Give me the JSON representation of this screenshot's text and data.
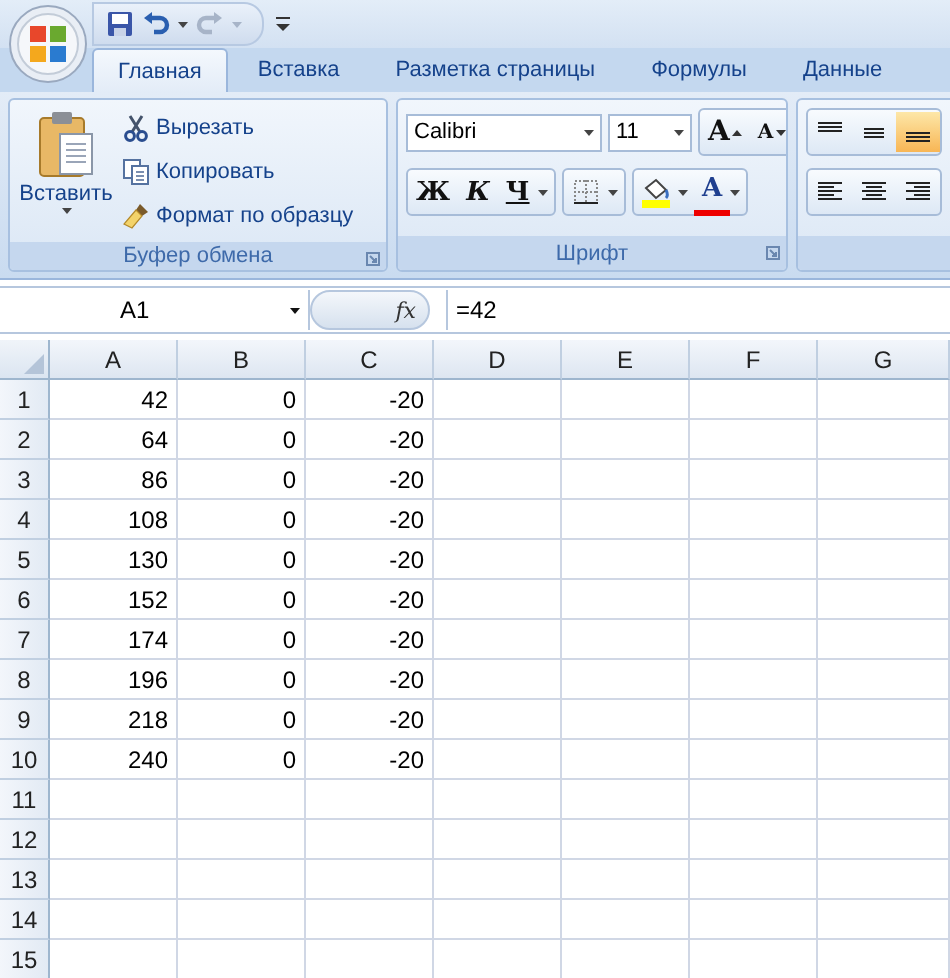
{
  "tabs": [
    {
      "label": "Главная",
      "selected": true
    },
    {
      "label": "Вставка",
      "selected": false
    },
    {
      "label": "Разметка страницы",
      "selected": false
    },
    {
      "label": "Формулы",
      "selected": false
    },
    {
      "label": "Данные",
      "selected": false
    }
  ],
  "clipboard": {
    "paste_label": "Вставить",
    "items": [
      {
        "kind": "cut",
        "label": "Вырезать"
      },
      {
        "kind": "copy",
        "label": "Копировать"
      },
      {
        "kind": "format",
        "label": "Формат по образцу"
      }
    ],
    "title": "Буфер обмена"
  },
  "font": {
    "font_name": "Calibri",
    "font_size": "11",
    "grow": "A",
    "shrink": "A",
    "bold": "Ж",
    "italic": "К",
    "underline": "Ч",
    "font_color": "A",
    "title": "Шрифт"
  },
  "alignment": {
    "vertical": [
      {
        "selected": false
      },
      {
        "selected": false
      },
      {
        "selected": true
      }
    ]
  },
  "formula_bar": {
    "name_box": "A1",
    "function_label": "fx",
    "formula": "=42"
  },
  "sheet": {
    "columns": [
      "A",
      "B",
      "C",
      "D",
      "E",
      "F",
      "G"
    ],
    "rows": [
      {
        "header": "1",
        "cells": [
          "42",
          "0",
          "-20"
        ]
      },
      {
        "header": "2",
        "cells": [
          "64",
          "0",
          "-20"
        ]
      },
      {
        "header": "3",
        "cells": [
          "86",
          "0",
          "-20"
        ]
      },
      {
        "header": "4",
        "cells": [
          "108",
          "0",
          "-20"
        ]
      },
      {
        "header": "5",
        "cells": [
          "130",
          "0",
          "-20"
        ]
      },
      {
        "header": "6",
        "cells": [
          "152",
          "0",
          "-20"
        ]
      },
      {
        "header": "7",
        "cells": [
          "174",
          "0",
          "-20"
        ]
      },
      {
        "header": "8",
        "cells": [
          "196",
          "0",
          "-20"
        ]
      },
      {
        "header": "9",
        "cells": [
          "218",
          "0",
          "-20"
        ]
      },
      {
        "header": "10",
        "cells": [
          "240",
          "0",
          "-20"
        ]
      },
      {
        "header": "11",
        "cells": []
      },
      {
        "header": "12",
        "cells": []
      },
      {
        "header": "13",
        "cells": []
      },
      {
        "header": "14",
        "cells": []
      },
      {
        "header": "15",
        "cells": []
      }
    ]
  }
}
